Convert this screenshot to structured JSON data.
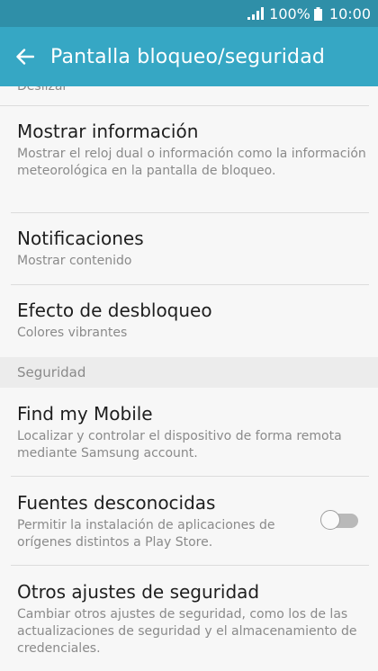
{
  "status_bar": {
    "battery_pct": "100%",
    "time": "10:00",
    "icons": [
      "signal-icon",
      "battery-icon"
    ]
  },
  "app_bar": {
    "title": "Pantalla bloqueo/seguridad",
    "back_icon": "back-arrow-icon"
  },
  "partial_item": {
    "summary": "Deslizar"
  },
  "items": [
    {
      "title": "Mostrar información",
      "summary": "Mostrar el reloj dual o información como la información meteorológica en la pantalla de bloqueo."
    },
    {
      "title": "Notificaciones",
      "summary": "Mostrar contenido"
    },
    {
      "title": "Efecto de desbloqueo",
      "summary": "Colores vibrantes"
    }
  ],
  "section_header": "Seguridad",
  "security_items": [
    {
      "title": "Find my Mobile",
      "summary": "Localizar y controlar el dispositivo de forma remota mediante Samsung account."
    },
    {
      "title": "Fuentes desconocidas",
      "summary": "Permitir la instalación de aplicaciones de orígenes distintos a Play Store.",
      "toggle_on": false
    },
    {
      "title": "Otros ajustes de seguridad",
      "summary": "Cambiar otros ajustes de seguridad, como los de las actualizaciones de seguridad y el almacenamiento de credenciales."
    }
  ],
  "colors": {
    "status_bar": "#2f8fa8",
    "app_bar": "#36a7c4",
    "background": "#f7f7f7",
    "section_header_bg": "#ececec"
  }
}
